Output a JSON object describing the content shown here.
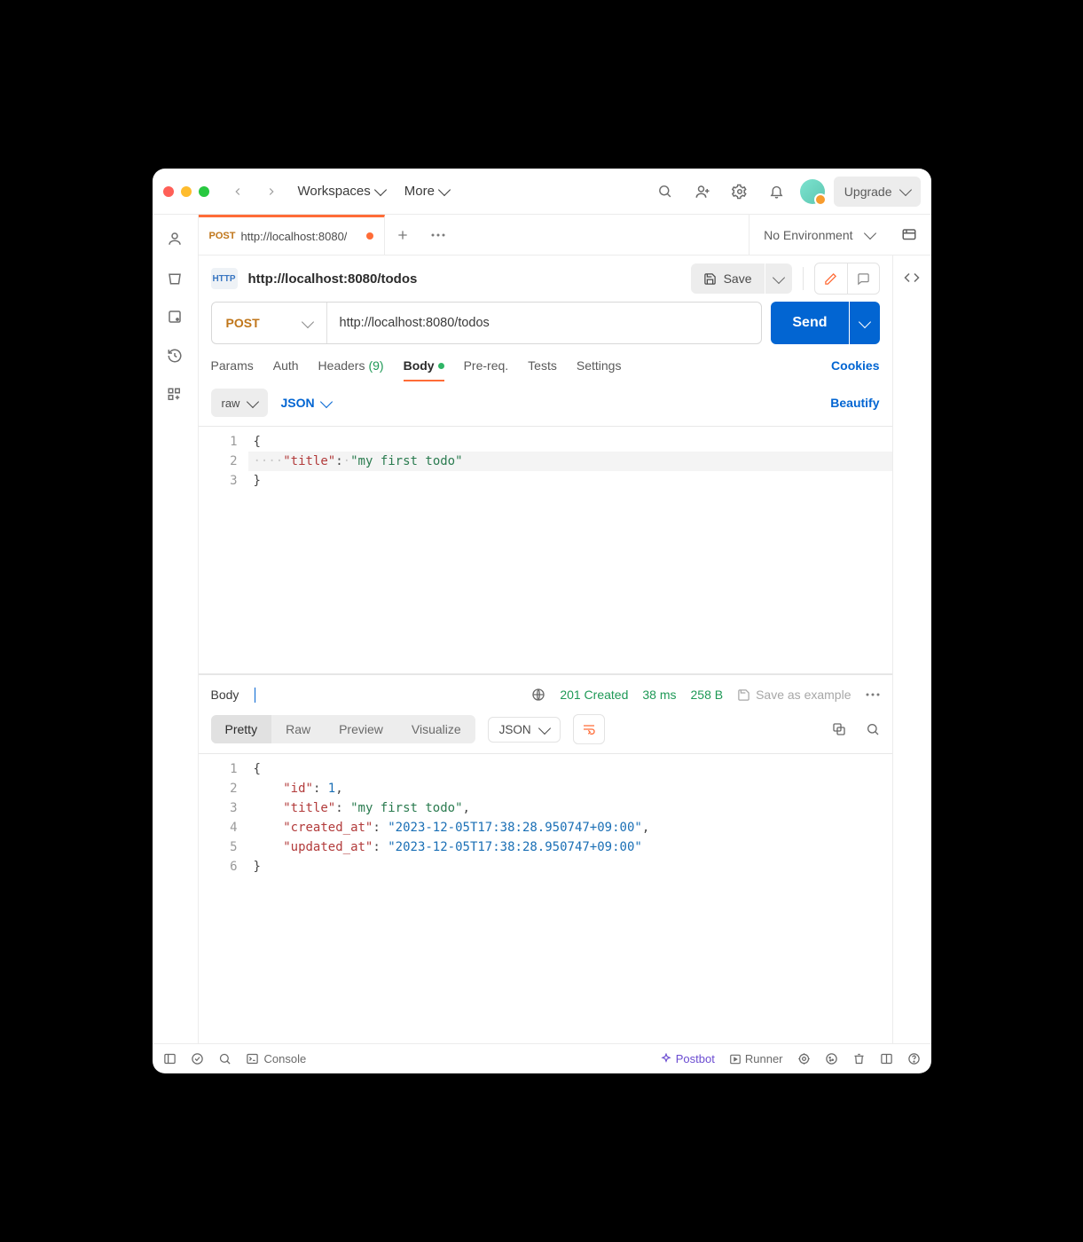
{
  "menus": {
    "workspaces": "Workspaces",
    "more": "More"
  },
  "upgrade_label": "Upgrade",
  "tab": {
    "method": "POST",
    "title": "http://localhost:8080/"
  },
  "environment": "No Environment",
  "request": {
    "path_display": "http://localhost:8080/todos",
    "save_label": "Save",
    "method": "POST",
    "url": "http://localhost:8080/todos",
    "send_label": "Send",
    "tabs": {
      "params": "Params",
      "auth": "Auth",
      "headers": "Headers",
      "headers_count": "(9)",
      "body": "Body",
      "prereq": "Pre-req.",
      "tests": "Tests",
      "settings": "Settings",
      "cookies": "Cookies"
    },
    "body_controls": {
      "raw": "raw",
      "json": "JSON",
      "beautify": "Beautify"
    },
    "body_lines": {
      "l1": "{",
      "l2_key": "\"title\"",
      "l2_val": "\"my first todo\"",
      "l3": "}"
    }
  },
  "response": {
    "label": "Body",
    "status": "201 Created",
    "time": "38 ms",
    "size": "258 B",
    "save_example": "Save as example",
    "views": {
      "pretty": "Pretty",
      "raw": "Raw",
      "preview": "Preview",
      "visualize": "Visualize"
    },
    "json_label": "JSON",
    "body": {
      "id_key": "\"id\"",
      "id_val": "1",
      "title_key": "\"title\"",
      "title_val": "\"my first todo\"",
      "created_key": "\"created_at\"",
      "created_val": "\"2023-12-05T17:38:28.950747+09:00\"",
      "updated_key": "\"updated_at\"",
      "updated_val": "\"2023-12-05T17:38:28.950747+09:00\""
    }
  },
  "statusbar": {
    "console": "Console",
    "postbot": "Postbot",
    "runner": "Runner"
  }
}
